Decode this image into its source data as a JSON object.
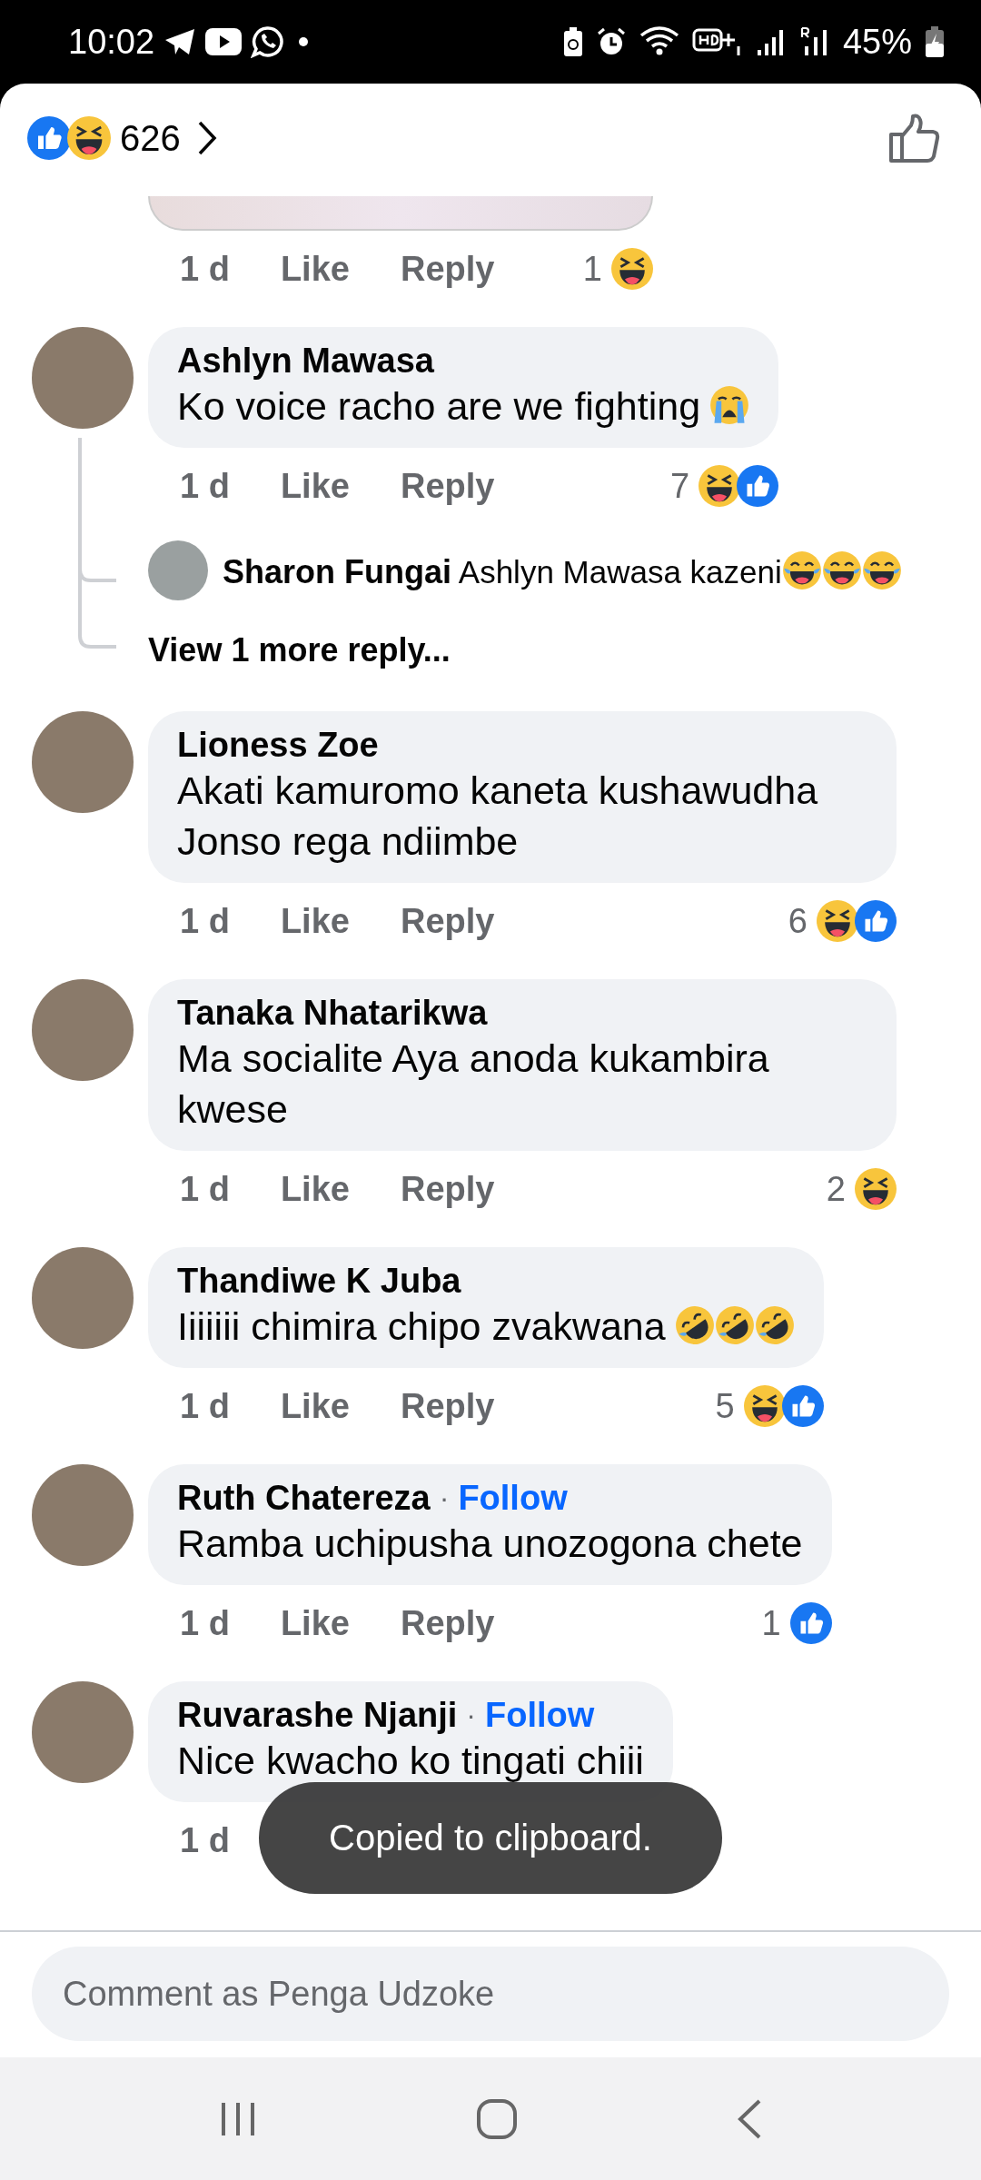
{
  "status_bar": {
    "time": "10:02",
    "battery": "45%"
  },
  "header": {
    "reactions": [
      {
        "kind": "like"
      },
      {
        "kind": "haha"
      }
    ],
    "count": "626"
  },
  "comments": [
    {
      "kind": "photo",
      "time": "1 d",
      "like": "Like",
      "reply": "Reply",
      "reaction_count": "1",
      "reactions": [
        {
          "kind": "haha"
        }
      ]
    },
    {
      "kind": "text",
      "author": "Ashlyn Mawasa",
      "text": "Ko voice racho are we fighting",
      "emojis": [
        {
          "kind": "cry"
        }
      ],
      "time": "1 d",
      "like": "Like",
      "reply": "Reply",
      "reaction_count": "7",
      "reactions": [
        {
          "kind": "haha"
        },
        {
          "kind": "like"
        }
      ],
      "replies": [
        {
          "author": "Sharon Fungai",
          "text": "Ashlyn Mawasa kazeni",
          "emojis": [
            {
              "kind": "joy"
            },
            {
              "kind": "joy"
            },
            {
              "kind": "joy"
            }
          ]
        }
      ],
      "more_replies": "View 1 more reply..."
    },
    {
      "kind": "text",
      "author": "Lioness Zoe",
      "text": "Akati kamuromo kaneta kushawudha Jonso rega ndiimbe",
      "time": "1 d",
      "like": "Like",
      "reply": "Reply",
      "reaction_count": "6",
      "reactions": [
        {
          "kind": "haha"
        },
        {
          "kind": "like"
        }
      ]
    },
    {
      "kind": "text",
      "author": "Tanaka Nhatarikwa",
      "text": "Ma socialite Aya anoda kukambira kwese",
      "time": "1 d",
      "like": "Like",
      "reply": "Reply",
      "reaction_count": "2",
      "reactions": [
        {
          "kind": "haha"
        }
      ]
    },
    {
      "kind": "text",
      "author": "Thandiwe K Juba",
      "text": "Iiiiiii chimira chipo zvakwana",
      "emojis": [
        {
          "kind": "rofl"
        },
        {
          "kind": "rofl"
        },
        {
          "kind": "rofl"
        }
      ],
      "time": "1 d",
      "like": "Like",
      "reply": "Reply",
      "reaction_count": "5",
      "reactions": [
        {
          "kind": "haha"
        },
        {
          "kind": "like"
        }
      ]
    },
    {
      "kind": "text",
      "author": "Ruth Chatereza",
      "separator": "·",
      "follow": "Follow",
      "text": "Ramba uchipusha unozogona chete",
      "time": "1 d",
      "like": "Like",
      "reply": "Reply",
      "reaction_count": "1",
      "reactions": [
        {
          "kind": "like"
        }
      ]
    },
    {
      "kind": "text",
      "author": "Ruvarashe Njanji",
      "separator": "·",
      "follow": "Follow",
      "text": "Nice kwacho ko tingati chiii",
      "time": "1 d"
    }
  ],
  "composer": {
    "placeholder": "Comment as Penga Udzoke"
  },
  "toast": {
    "text": "Copied to clipboard."
  }
}
